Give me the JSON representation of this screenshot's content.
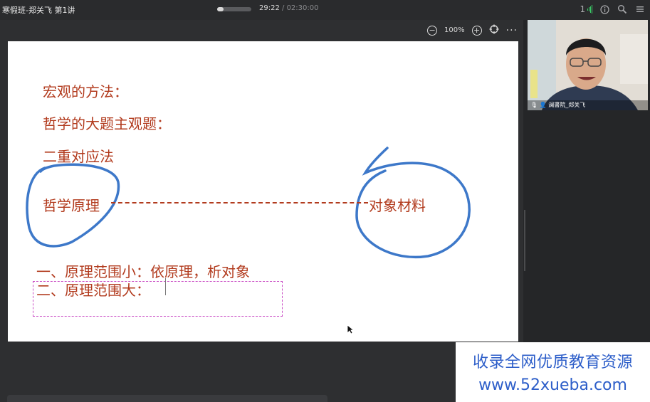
{
  "header": {
    "course_title": "寒假班-郑关飞 第1讲",
    "playback": {
      "current_time": "29:22",
      "separator": " / ",
      "total_time": "02:30:00",
      "progress": 0.196
    },
    "signal_label": "1"
  },
  "toolbar": {
    "zoom": "100%"
  },
  "slide": {
    "lines": {
      "macro_method": "宏观的方法：",
      "subjective_question": "哲学的大题主观题：",
      "dual_correspondence": "二重对应法",
      "philosophy_principle": "哲学原理",
      "object_material": "对象材料",
      "scope_small": "一、原理范围小：依原理，析对象",
      "scope_large": "二、原理范围大："
    },
    "colors": {
      "text": "#b23b1e",
      "ink": "#3d78c9",
      "selection": "#c94bc4"
    }
  },
  "webcam": {
    "label": "澜書院_郑关飞"
  },
  "watermark": {
    "line1": "收录全网优质教育资源",
    "line2": "www.52xueba.com"
  },
  "icons": [
    "signal-icon",
    "info-icon",
    "tools-icon",
    "menu-icon",
    "zoom-out-icon",
    "zoom-in-icon",
    "fit-icon",
    "more-icon",
    "mic-icon",
    "user-icon",
    "cursor-icon"
  ]
}
